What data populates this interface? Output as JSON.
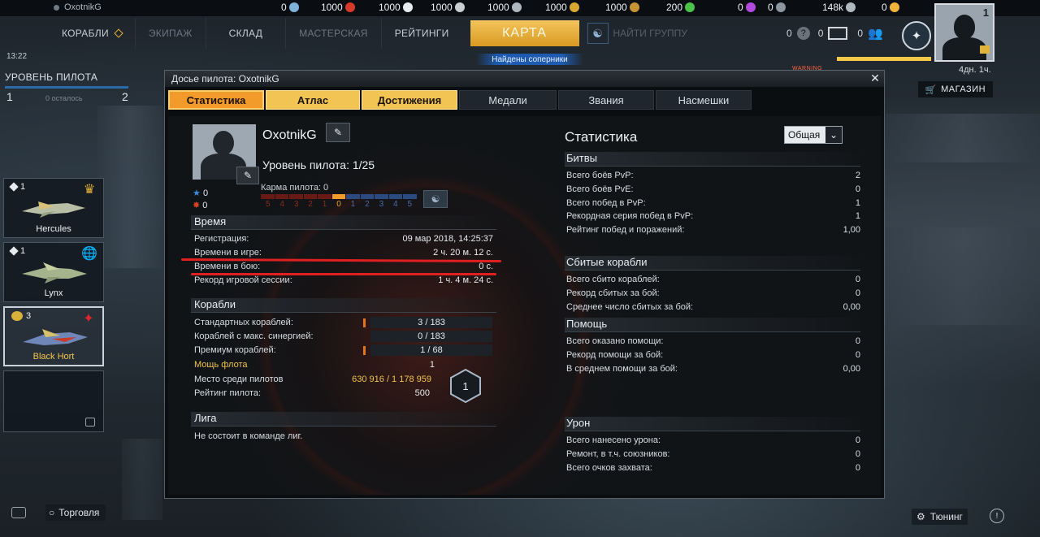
{
  "top": {
    "username": "OxotnikG",
    "resources": [
      {
        "value": "0",
        "color": "#7fb2d8"
      },
      {
        "value": "1000",
        "color": "#d83a2a"
      },
      {
        "value": "1000",
        "color": "#e7ecf0"
      },
      {
        "value": "1000",
        "color": "#c9ced3"
      },
      {
        "value": "1000",
        "color": "#b0b8c0"
      },
      {
        "value": "1000",
        "color": "#d8a830"
      },
      {
        "value": "1000",
        "color": "#c69434"
      },
      {
        "value": "200",
        "color": "#4bc24a"
      },
      {
        "value": "0",
        "color": "#b14be0"
      },
      {
        "value": "0",
        "color": "#8c96a0"
      },
      {
        "value": "148k",
        "color": "#b0b8c0"
      },
      {
        "value": "0",
        "color": "#f0b43a"
      }
    ]
  },
  "nav": {
    "ships": "КОРАБЛИ",
    "crew": "ЭКИПАЖ",
    "storage": "СКЛАД",
    "workshop": "МАСТЕРСКАЯ",
    "ratings": "РЕЙТИНГИ",
    "map": "КАРТА",
    "find_group": "НАЙТИ ГРУППУ",
    "found_rivals": "Найдены соперники",
    "help_count": "0",
    "mail_count": "0",
    "friends_count": "0",
    "avatar_level": "1",
    "time_left": "4дн. 1ч.",
    "shop": "МАГАЗИН",
    "warning": "WARNING"
  },
  "left": {
    "clock": "13:22",
    "pilot_level_label": "УРОВЕНЬ ПИЛОТА",
    "level_from": "1",
    "level_to": "2",
    "remaining": "0 осталось",
    "ships": [
      {
        "count": "1",
        "name": "Hercules",
        "rank_icon": "eagle-icon",
        "active": false
      },
      {
        "count": "1",
        "name": "Lynx",
        "rank_icon": "globe-icon",
        "active": false
      },
      {
        "count": "3",
        "name": "Black Hort",
        "rank_icon": "red-emblem-icon",
        "active": true
      }
    ],
    "trade": "Торговля",
    "tuning": "Тюнинг"
  },
  "dialog": {
    "title": "Досье пилота: OxotnikG",
    "tabs": [
      {
        "label": "Статистика",
        "style": "sel",
        "width": 118
      },
      {
        "label": "Атлас",
        "style": "gold",
        "width": 116
      },
      {
        "label": "Достижения",
        "style": "gold",
        "width": 118
      },
      {
        "label": "Медали",
        "style": "",
        "width": 120
      },
      {
        "label": "Звания",
        "style": "",
        "width": 118
      },
      {
        "label": "Насмешки",
        "style": "",
        "width": 118
      }
    ],
    "profile": {
      "name": "OxotnikG",
      "level": "Уровень пилота: 1/25",
      "karma_label": "Карма пилота: 0",
      "karma_scale": [
        "5",
        "4",
        "3",
        "2",
        "1",
        "0",
        "1",
        "2",
        "3",
        "4",
        "5"
      ],
      "stars": "0",
      "kills": "0"
    },
    "time": {
      "heading": "Время",
      "rows": [
        {
          "k": "Регистрация:",
          "v": "09 мар 2018, 14:25:37"
        },
        {
          "k": "Времени в игре:",
          "v": "2 ч. 20 м. 12 с."
        },
        {
          "k": "Времени в бою:",
          "v": "0 с."
        },
        {
          "k": "Рекорд игровой сессии:",
          "v": "1 ч. 4 м. 24 с."
        }
      ]
    },
    "ships": {
      "heading": "Корабли",
      "rows": [
        {
          "k": "Стандартных кораблей:",
          "v": "3 / 183",
          "mark": true
        },
        {
          "k": "Кораблей с макс. синергией:",
          "v": "0 / 183",
          "mark": false
        },
        {
          "k": "Премиум кораблей:",
          "v": "1 / 68",
          "mark": true
        }
      ],
      "power_label": "Мощь флота",
      "power_value": "1",
      "place_label": "Место среди пилотов",
      "place_value": "630 916 / 1 178 959",
      "rating_label": "Рейтинг пилота:",
      "rating_value": "500",
      "rank_badge": "1"
    },
    "league": {
      "heading": "Лига",
      "text": "Не состоит в команде лиг."
    },
    "stats": {
      "title": "Статистика",
      "filter": "Общая",
      "battles": {
        "heading": "Битвы",
        "rows": [
          {
            "k": "Всего боёв PvP:",
            "v": "2"
          },
          {
            "k": "Всего боёв PvE:",
            "v": "0"
          },
          {
            "k": "Всего побед в PvP:",
            "v": "1"
          },
          {
            "k": "Рекордная серия побед в PvP:",
            "v": "1"
          },
          {
            "k": "Рейтинг побед и поражений:",
            "v": "1,00"
          }
        ]
      },
      "kills": {
        "heading": "Сбитые корабли",
        "rows": [
          {
            "k": "Всего сбито кораблей:",
            "v": "0"
          },
          {
            "k": "Рекорд сбитых за бой:",
            "v": "0"
          },
          {
            "k": "Среднее число сбитых за бой:",
            "v": "0,00"
          }
        ]
      },
      "assist": {
        "heading": "Помощь",
        "rows": [
          {
            "k": "Всего оказано помощи:",
            "v": "0"
          },
          {
            "k": "Рекорд помощи за бой:",
            "v": "0"
          },
          {
            "k": "В среднем помощи за бой:",
            "v": "0,00"
          }
        ]
      },
      "damage": {
        "heading": "Урон",
        "rows": [
          {
            "k": "Всего нанесено урона:",
            "v": "0"
          },
          {
            "k": "Ремонт, в т.ч. союзников:",
            "v": "0"
          },
          {
            "k": "Всего очков захвата:",
            "v": "0"
          }
        ]
      }
    }
  }
}
